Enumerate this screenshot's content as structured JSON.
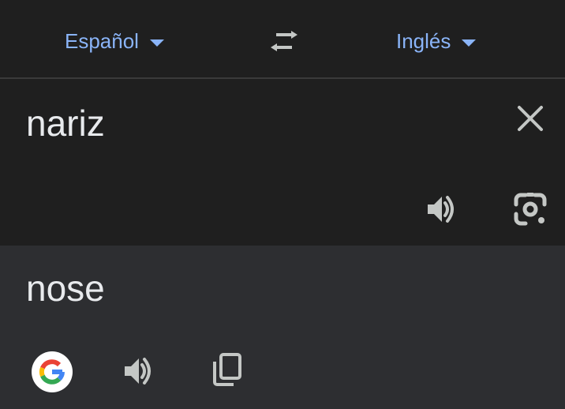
{
  "languages": {
    "source": "Español",
    "target": "Inglés"
  },
  "input": {
    "text": "nariz"
  },
  "output": {
    "text": "nose"
  },
  "icons": {
    "swap": "swap-arrows-icon",
    "clear": "close-icon",
    "listen_source": "speaker-icon",
    "camera": "lens-camera-icon",
    "google": "google-logo-icon",
    "listen_target": "speaker-icon",
    "copy": "copy-icon"
  },
  "colors": {
    "accent": "#8ab4f8",
    "text": "#e8eaed",
    "icon": "#c4c7c5",
    "top_bg": "#1f1f1f",
    "output_bg": "#2d2e31"
  }
}
